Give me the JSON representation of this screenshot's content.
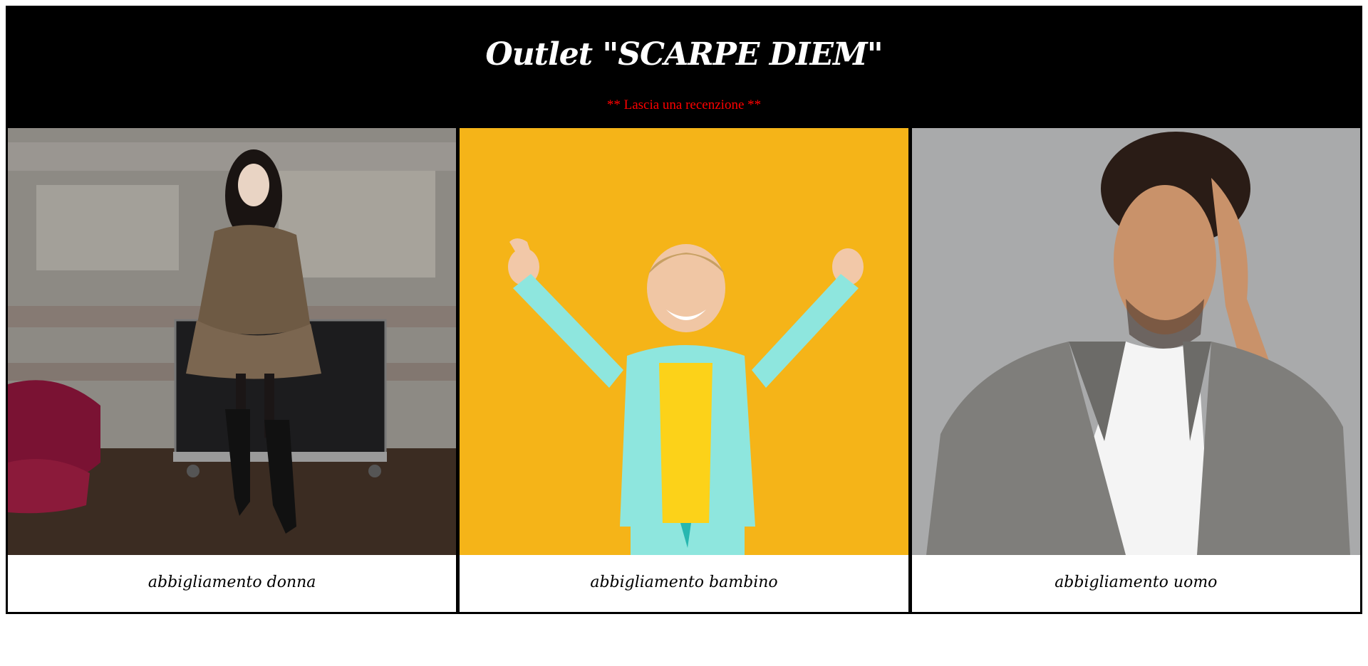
{
  "header": {
    "title": "Outlet \"SCARPE DIEM\"",
    "review_link": "** Lascia una recenzione **"
  },
  "cards": [
    {
      "caption": "abbigliamento donna",
      "photo_icon": "woman-photo"
    },
    {
      "caption": "abbigliamento bambino",
      "photo_icon": "child-photo"
    },
    {
      "caption": "abbigliamento uomo",
      "photo_icon": "man-photo"
    }
  ],
  "colors": {
    "header_bg": "#000000",
    "title": "#ffffff",
    "link": "#ff0000",
    "child_bg": "#f5b418",
    "man_bg": "#a9aaab"
  }
}
